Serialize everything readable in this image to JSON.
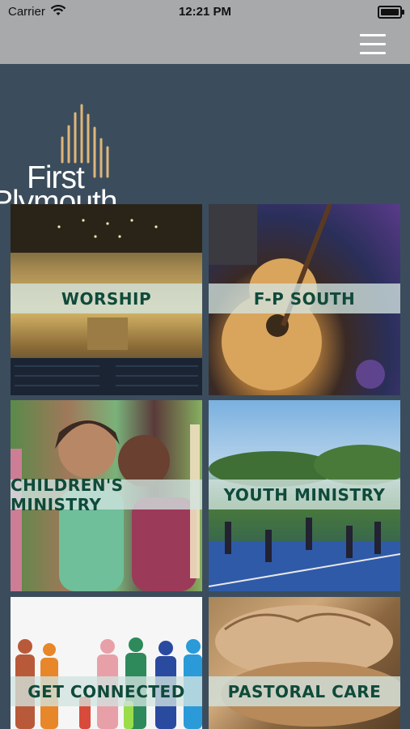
{
  "status": {
    "carrier": "Carrier",
    "time": "12:21 PM"
  },
  "logo": {
    "line1": "First",
    "line2": "Plymouth"
  },
  "tiles": [
    {
      "label": "WORSHIP"
    },
    {
      "label": "F-P SOUTH"
    },
    {
      "label": "CHILDREN'S MINISTRY"
    },
    {
      "label": "YOUTH MINISTRY"
    },
    {
      "label": "GET CONNECTED"
    },
    {
      "label": "PASTORAL CARE"
    }
  ],
  "colors": {
    "brand_gold": "#e0b57a",
    "label_text": "#0f4a3a",
    "background": "#3b4d5c"
  }
}
